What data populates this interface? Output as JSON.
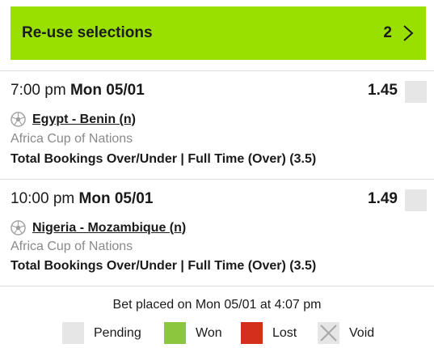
{
  "reuse": {
    "label": "Re-use selections",
    "count": "2",
    "icon": "chevron-right-icon",
    "color": "#99e000"
  },
  "selections": [
    {
      "time": "7:00 pm",
      "date": "Mon 05/01",
      "odds": "1.45",
      "match": "Egypt - Benin (n)",
      "competition": "Africa Cup of Nations",
      "market": "Total Bookings Over/Under | Full Time (Over) (3.5)",
      "status": "pending"
    },
    {
      "time": "10:00 pm",
      "date": "Mon 05/01",
      "odds": "1.49",
      "match": "Nigeria - Mozambique (n)",
      "competition": "Africa Cup of Nations",
      "market": "Total Bookings Over/Under | Full Time (Over) (3.5)",
      "status": "pending"
    }
  ],
  "placed": "Bet placed on Mon 05/01 at 4:07 pm",
  "legend": [
    {
      "label": "Pending",
      "color": "#e6e6e6"
    },
    {
      "label": "Won",
      "color": "#8cc63f"
    },
    {
      "label": "Lost",
      "color": "#d32f1c"
    },
    {
      "label": "Void",
      "color": "#e6e6e6"
    }
  ]
}
